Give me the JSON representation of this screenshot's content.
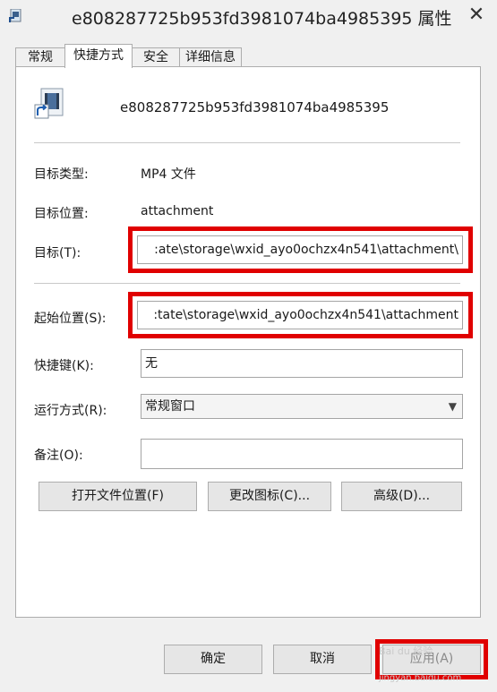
{
  "window": {
    "title": "e808287725b953fd3981074ba4985395 属性",
    "close_glyph": "✕"
  },
  "tabs": [
    {
      "label": "常规"
    },
    {
      "label": "快捷方式"
    },
    {
      "label": "安全"
    },
    {
      "label": "详细信息"
    }
  ],
  "shortcut": {
    "name": "e808287725b953fd3981074ba4985395",
    "target_type_label": "目标类型:",
    "target_type_value": "MP4 文件",
    "target_location_label": "目标位置:",
    "target_location_value": "attachment",
    "target_label": "目标(T):",
    "target_value": ":ate\\storage\\wxid_ayo0ochzx4n541\\attachment\\",
    "start_in_label": "起始位置(S):",
    "start_in_value": ":tate\\storage\\wxid_ayo0ochzx4n541\\attachment",
    "hotkey_label": "快捷键(K):",
    "hotkey_value": "无",
    "run_label": "运行方式(R):",
    "run_value": "常规窗口",
    "comment_label": "备注(O):",
    "comment_value": ""
  },
  "buttons": {
    "open_location": "打开文件位置(F)",
    "change_icon": "更改图标(C)...",
    "advanced": "高级(D)..."
  },
  "footer": {
    "ok": "确定",
    "cancel": "取消",
    "apply": "应用(A)"
  },
  "watermark": {
    "brand": "Bai du 经验",
    "url": "jingyan.baidu.com"
  },
  "colors": {
    "highlight": "#e00000"
  }
}
